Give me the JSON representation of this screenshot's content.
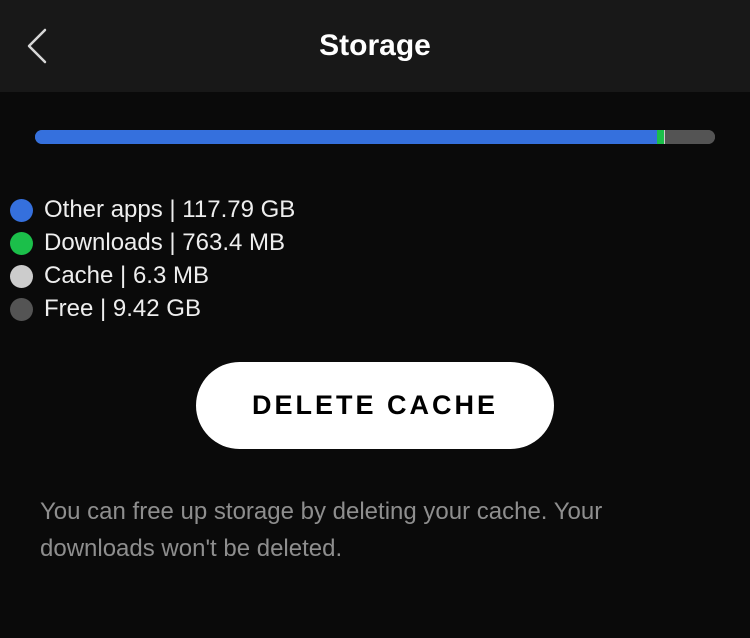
{
  "header": {
    "title": "Storage"
  },
  "storage_bar": {
    "segments": [
      {
        "key": "other_apps",
        "color": "#3570dd",
        "percent": 91.5
      },
      {
        "key": "downloads",
        "color": "#1bbf4a",
        "percent": 1.0
      },
      {
        "key": "cache",
        "color": "#cccccc",
        "percent": 0.1
      },
      {
        "key": "free",
        "color": "#545454",
        "percent": 7.4
      }
    ]
  },
  "legend": {
    "items": [
      {
        "dot_color": "#3570dd",
        "label": "Other apps | 117.79 GB"
      },
      {
        "dot_color": "#1bbf4a",
        "label": "Downloads | 763.4 MB"
      },
      {
        "dot_color": "#cccccc",
        "label": "Cache | 6.3 MB"
      },
      {
        "dot_color": "#545454",
        "label": "Free | 9.42 GB"
      }
    ]
  },
  "delete_cache_button": "DELETE CACHE",
  "description": "You can free up storage by deleting your cache. Your downloads won't be deleted."
}
